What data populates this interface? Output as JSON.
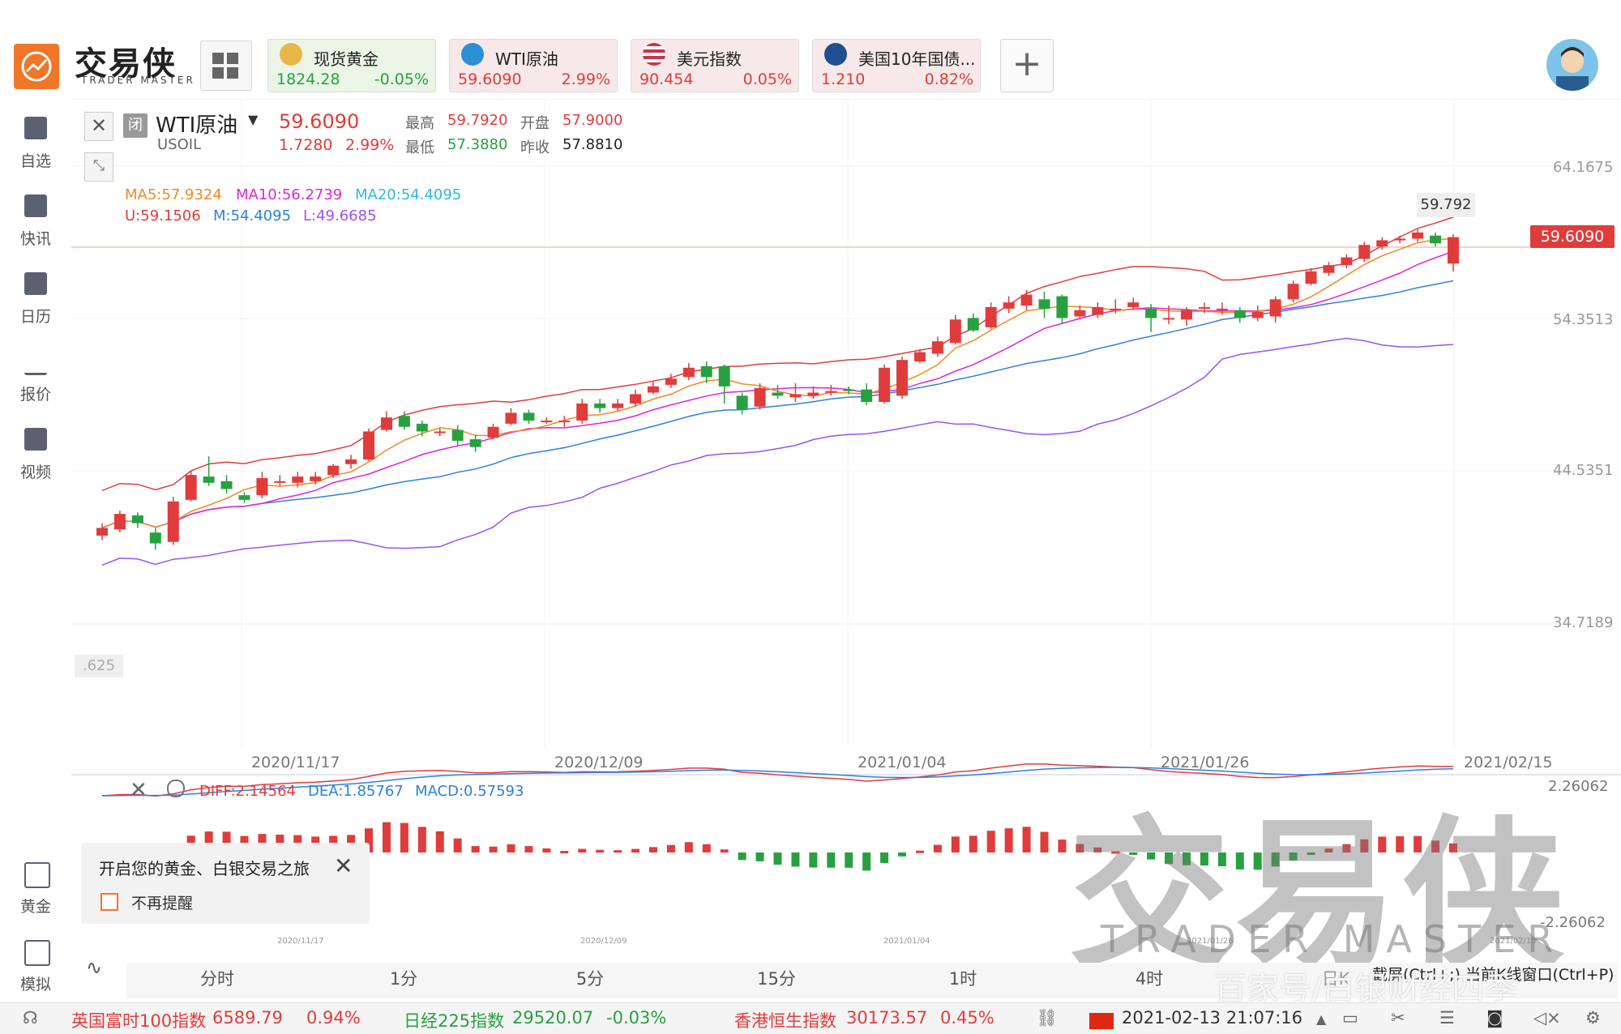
{
  "window": {
    "minimize": "−",
    "restore": "⧉",
    "close": "✕"
  },
  "brand": {
    "name_cn": "交易侠",
    "name_en": "TRADER MASTER"
  },
  "quotes": [
    {
      "name": "现货黄金",
      "price": "1824.28",
      "change": "-0.05%",
      "dir": "down",
      "icon_color": "#e8b64a"
    },
    {
      "name": "WTI原油",
      "price": "59.6090",
      "change": "2.99%",
      "dir": "up",
      "icon_color": "#2b8fd6"
    },
    {
      "name": "美元指数",
      "price": "90.454",
      "change": "0.05%",
      "dir": "up",
      "icon_color": "#c8354a"
    },
    {
      "name": "美国10年国债...",
      "price": "1.210",
      "change": "0.82%",
      "dir": "up",
      "icon_color": "#1d4f91"
    }
  ],
  "add_label": "+",
  "sidebar": {
    "top": [
      {
        "label": "自选"
      },
      {
        "label": "快讯"
      },
      {
        "label": "日历"
      },
      {
        "label": "报价"
      },
      {
        "label": "视频"
      }
    ],
    "bottom": [
      {
        "label": "黄金"
      },
      {
        "label": "模拟"
      }
    ]
  },
  "instrument": {
    "status": "闭",
    "name": "WTI原油",
    "symbol": "USOIL",
    "price": "59.6090",
    "change": "1.7280",
    "change_pct": "2.99%",
    "high_label": "最高",
    "high": "59.7920",
    "open_label": "开盘",
    "open": "57.9000",
    "low_label": "最低",
    "low": "57.3880",
    "prev_label": "昨收",
    "prev": "57.8810"
  },
  "indicators": {
    "ma5": "MA5:57.9324",
    "ma10": "MA10:56.2739",
    "ma20": "MA20:54.4095",
    "boll_u": "U:59.1506",
    "boll_m": "M:54.4095",
    "boll_l": "L:49.6685"
  },
  "macd": {
    "diff": "DIFF:2.14564",
    "dea": "DEA:1.85767",
    "macd": "MACD:0.57593",
    "top": "2.26062",
    "bottom": "-2.26062"
  },
  "price_axis": [
    "64.1675",
    "54.3513",
    "44.5351",
    "34.7189"
  ],
  "date_axis": [
    "2020/11/17",
    "2020/12/09",
    "2021/01/04",
    "2021/01/26",
    "2021/02/15"
  ],
  "mini_dates": [
    "2020/11/17",
    "2020/12/09",
    "2021/01/04",
    "2021/01/26",
    "2021/02/15"
  ],
  "price_tag": "59.6090",
  "high_tag": "59.792",
  "low_tag": ".625",
  "watermark": {
    "cn": "交易侠",
    "en": "TRADER MASTER",
    "tail": "百家号/白银财经四季"
  },
  "popup": {
    "text": "开启您的黄金、白银交易之旅",
    "checkbox": "不再提醒",
    "close": "✕"
  },
  "periods": [
    "分时",
    "1分",
    "5分",
    "15分",
    "1时",
    "4时",
    "日K"
  ],
  "screenshot_hint": "截屏(Ctrl+;) 当前K线窗口(Ctrl+P)",
  "bottom_bar": {
    "indices": [
      {
        "name": "英国富时100指数",
        "value": "6589.79",
        "change": "0.94%",
        "color": "#e03c3c"
      },
      {
        "name": "日经225指数",
        "value": "29520.07",
        "change": "-0.03%",
        "color": "#27a140"
      },
      {
        "name": "香港恒生指数",
        "value": "30173.57",
        "change": "0.45%",
        "color": "#e03c3c"
      }
    ],
    "datetime": "2021-02-13 21:07:16"
  },
  "colors": {
    "up": "#e03c3c",
    "down": "#27a140",
    "ma5": "#f08a22",
    "ma10": "#e024d8",
    "ma20": "#2db8e0",
    "boll_u": "#e03c3c",
    "boll_m": "#2f7fe0",
    "boll_l": "#a050f0"
  },
  "chart_data": {
    "type": "candlestick",
    "dates": [
      "2020/11/17",
      "2020/12/09",
      "2021/01/04",
      "2021/01/26",
      "2021/02/15"
    ],
    "ylim": [
      34.7189,
      64.1675
    ],
    "candles": [
      {
        "o": 40.4,
        "c": 40.9,
        "h": 41.2,
        "l": 40.1
      },
      {
        "o": 40.8,
        "c": 41.8,
        "h": 42.0,
        "l": 40.6
      },
      {
        "o": 41.7,
        "c": 41.2,
        "h": 41.9,
        "l": 40.9
      },
      {
        "o": 40.6,
        "c": 39.9,
        "h": 40.9,
        "l": 39.5
      },
      {
        "o": 40.0,
        "c": 42.6,
        "h": 42.9,
        "l": 39.8
      },
      {
        "o": 42.7,
        "c": 44.3,
        "h": 44.6,
        "l": 42.6
      },
      {
        "o": 44.2,
        "c": 43.8,
        "h": 45.5,
        "l": 43.6
      },
      {
        "o": 43.9,
        "c": 43.4,
        "h": 44.3,
        "l": 43.1
      },
      {
        "o": 43.0,
        "c": 42.7,
        "h": 43.2,
        "l": 42.5
      },
      {
        "o": 43.0,
        "c": 44.1,
        "h": 44.5,
        "l": 42.8
      },
      {
        "o": 43.9,
        "c": 43.9,
        "h": 44.3,
        "l": 43.6
      },
      {
        "o": 43.8,
        "c": 44.2,
        "h": 44.5,
        "l": 43.5
      },
      {
        "o": 43.9,
        "c": 44.2,
        "h": 44.5,
        "l": 43.7
      },
      {
        "o": 44.3,
        "c": 44.9,
        "h": 45.0,
        "l": 44.1
      },
      {
        "o": 45.0,
        "c": 45.3,
        "h": 45.6,
        "l": 44.7
      },
      {
        "o": 45.3,
        "c": 47.1,
        "h": 47.3,
        "l": 45.2
      },
      {
        "o": 47.2,
        "c": 48.0,
        "h": 48.4,
        "l": 47.1
      },
      {
        "o": 48.1,
        "c": 47.4,
        "h": 48.4,
        "l": 47.2
      },
      {
        "o": 47.6,
        "c": 47.1,
        "h": 47.8,
        "l": 46.8
      },
      {
        "o": 47.0,
        "c": 47.1,
        "h": 47.3,
        "l": 46.8
      },
      {
        "o": 47.2,
        "c": 46.5,
        "h": 47.5,
        "l": 46.2
      },
      {
        "o": 46.6,
        "c": 46.1,
        "h": 46.9,
        "l": 45.8
      },
      {
        "o": 46.7,
        "c": 47.4,
        "h": 47.6,
        "l": 46.6
      },
      {
        "o": 47.6,
        "c": 48.3,
        "h": 48.6,
        "l": 47.5
      },
      {
        "o": 48.3,
        "c": 47.8,
        "h": 48.5,
        "l": 47.6
      },
      {
        "o": 47.8,
        "c": 47.8,
        "h": 48.0,
        "l": 47.6
      },
      {
        "o": 47.7,
        "c": 47.8,
        "h": 48.1,
        "l": 47.4
      },
      {
        "o": 47.8,
        "c": 48.9,
        "h": 49.2,
        "l": 47.6
      },
      {
        "o": 48.9,
        "c": 48.6,
        "h": 49.2,
        "l": 48.3
      },
      {
        "o": 48.6,
        "c": 48.9,
        "h": 49.2,
        "l": 48.4
      },
      {
        "o": 48.9,
        "c": 49.5,
        "h": 49.8,
        "l": 48.7
      },
      {
        "o": 49.6,
        "c": 50.0,
        "h": 50.3,
        "l": 49.5
      },
      {
        "o": 50.1,
        "c": 50.5,
        "h": 50.8,
        "l": 49.9
      },
      {
        "o": 50.6,
        "c": 51.2,
        "h": 51.5,
        "l": 50.4
      },
      {
        "o": 51.3,
        "c": 50.6,
        "h": 51.6,
        "l": 50.2
      },
      {
        "o": 51.3,
        "c": 50.0,
        "h": 51.4,
        "l": 48.9
      },
      {
        "o": 49.4,
        "c": 48.5,
        "h": 49.6,
        "l": 48.2
      },
      {
        "o": 48.7,
        "c": 49.9,
        "h": 50.2,
        "l": 48.5
      },
      {
        "o": 49.6,
        "c": 49.4,
        "h": 50.1,
        "l": 49.2
      },
      {
        "o": 49.3,
        "c": 49.5,
        "h": 50.2,
        "l": 49.0
      },
      {
        "o": 49.4,
        "c": 49.6,
        "h": 50.0,
        "l": 49.2
      },
      {
        "o": 49.6,
        "c": 49.7,
        "h": 50.1,
        "l": 49.4
      },
      {
        "o": 49.8,
        "c": 49.7,
        "h": 50.0,
        "l": 49.5
      },
      {
        "o": 49.8,
        "c": 49.0,
        "h": 50.2,
        "l": 48.8
      },
      {
        "o": 49.0,
        "c": 51.2,
        "h": 51.4,
        "l": 48.9
      },
      {
        "o": 49.4,
        "c": 51.7,
        "h": 51.9,
        "l": 49.2
      },
      {
        "o": 51.6,
        "c": 52.2,
        "h": 52.4,
        "l": 51.5
      },
      {
        "o": 52.1,
        "c": 52.9,
        "h": 53.2,
        "l": 51.9
      },
      {
        "o": 52.8,
        "c": 54.3,
        "h": 54.6,
        "l": 52.7
      },
      {
        "o": 54.4,
        "c": 53.6,
        "h": 54.7,
        "l": 53.5
      },
      {
        "o": 53.8,
        "c": 55.1,
        "h": 55.4,
        "l": 53.7
      },
      {
        "o": 55.0,
        "c": 55.4,
        "h": 55.8,
        "l": 54.7
      },
      {
        "o": 55.2,
        "c": 55.9,
        "h": 56.2,
        "l": 54.9
      },
      {
        "o": 55.6,
        "c": 55.0,
        "h": 56.1,
        "l": 54.4
      },
      {
        "o": 55.8,
        "c": 54.4,
        "h": 55.9,
        "l": 54.0
      },
      {
        "o": 54.5,
        "c": 54.9,
        "h": 55.2,
        "l": 54.3
      },
      {
        "o": 54.6,
        "c": 55.1,
        "h": 55.4,
        "l": 54.4
      },
      {
        "o": 54.9,
        "c": 55.0,
        "h": 55.6,
        "l": 54.7
      },
      {
        "o": 55.1,
        "c": 55.4,
        "h": 55.7,
        "l": 54.9
      },
      {
        "o": 55.0,
        "c": 54.4,
        "h": 55.3,
        "l": 53.5
      },
      {
        "o": 54.4,
        "c": 54.4,
        "h": 55.2,
        "l": 54.0
      },
      {
        "o": 54.3,
        "c": 54.9,
        "h": 55.1,
        "l": 53.9
      },
      {
        "o": 55.0,
        "c": 55.1,
        "h": 55.4,
        "l": 54.7
      },
      {
        "o": 55.0,
        "c": 55.0,
        "h": 55.4,
        "l": 54.6
      },
      {
        "o": 54.9,
        "c": 54.4,
        "h": 55.1,
        "l": 54.1
      },
      {
        "o": 54.4,
        "c": 54.8,
        "h": 55.2,
        "l": 54.2
      },
      {
        "o": 54.5,
        "c": 55.6,
        "h": 55.8,
        "l": 54.1
      },
      {
        "o": 55.6,
        "c": 56.6,
        "h": 56.8,
        "l": 55.4
      },
      {
        "o": 56.6,
        "c": 57.4,
        "h": 57.6,
        "l": 56.5
      },
      {
        "o": 57.3,
        "c": 57.8,
        "h": 58.0,
        "l": 57.1
      },
      {
        "o": 57.8,
        "c": 58.3,
        "h": 58.5,
        "l": 57.6
      },
      {
        "o": 58.2,
        "c": 59.1,
        "h": 59.3,
        "l": 58.0
      },
      {
        "o": 59.0,
        "c": 59.4,
        "h": 59.6,
        "l": 58.8
      },
      {
        "o": 59.4,
        "c": 59.5,
        "h": 59.7,
        "l": 59.2
      },
      {
        "o": 59.5,
        "c": 59.9,
        "h": 60.1,
        "l": 59.3
      },
      {
        "o": 59.7,
        "c": 59.2,
        "h": 59.9,
        "l": 59.0
      },
      {
        "o": 57.9,
        "c": 59.6,
        "h": 59.792,
        "l": 57.388
      }
    ]
  }
}
